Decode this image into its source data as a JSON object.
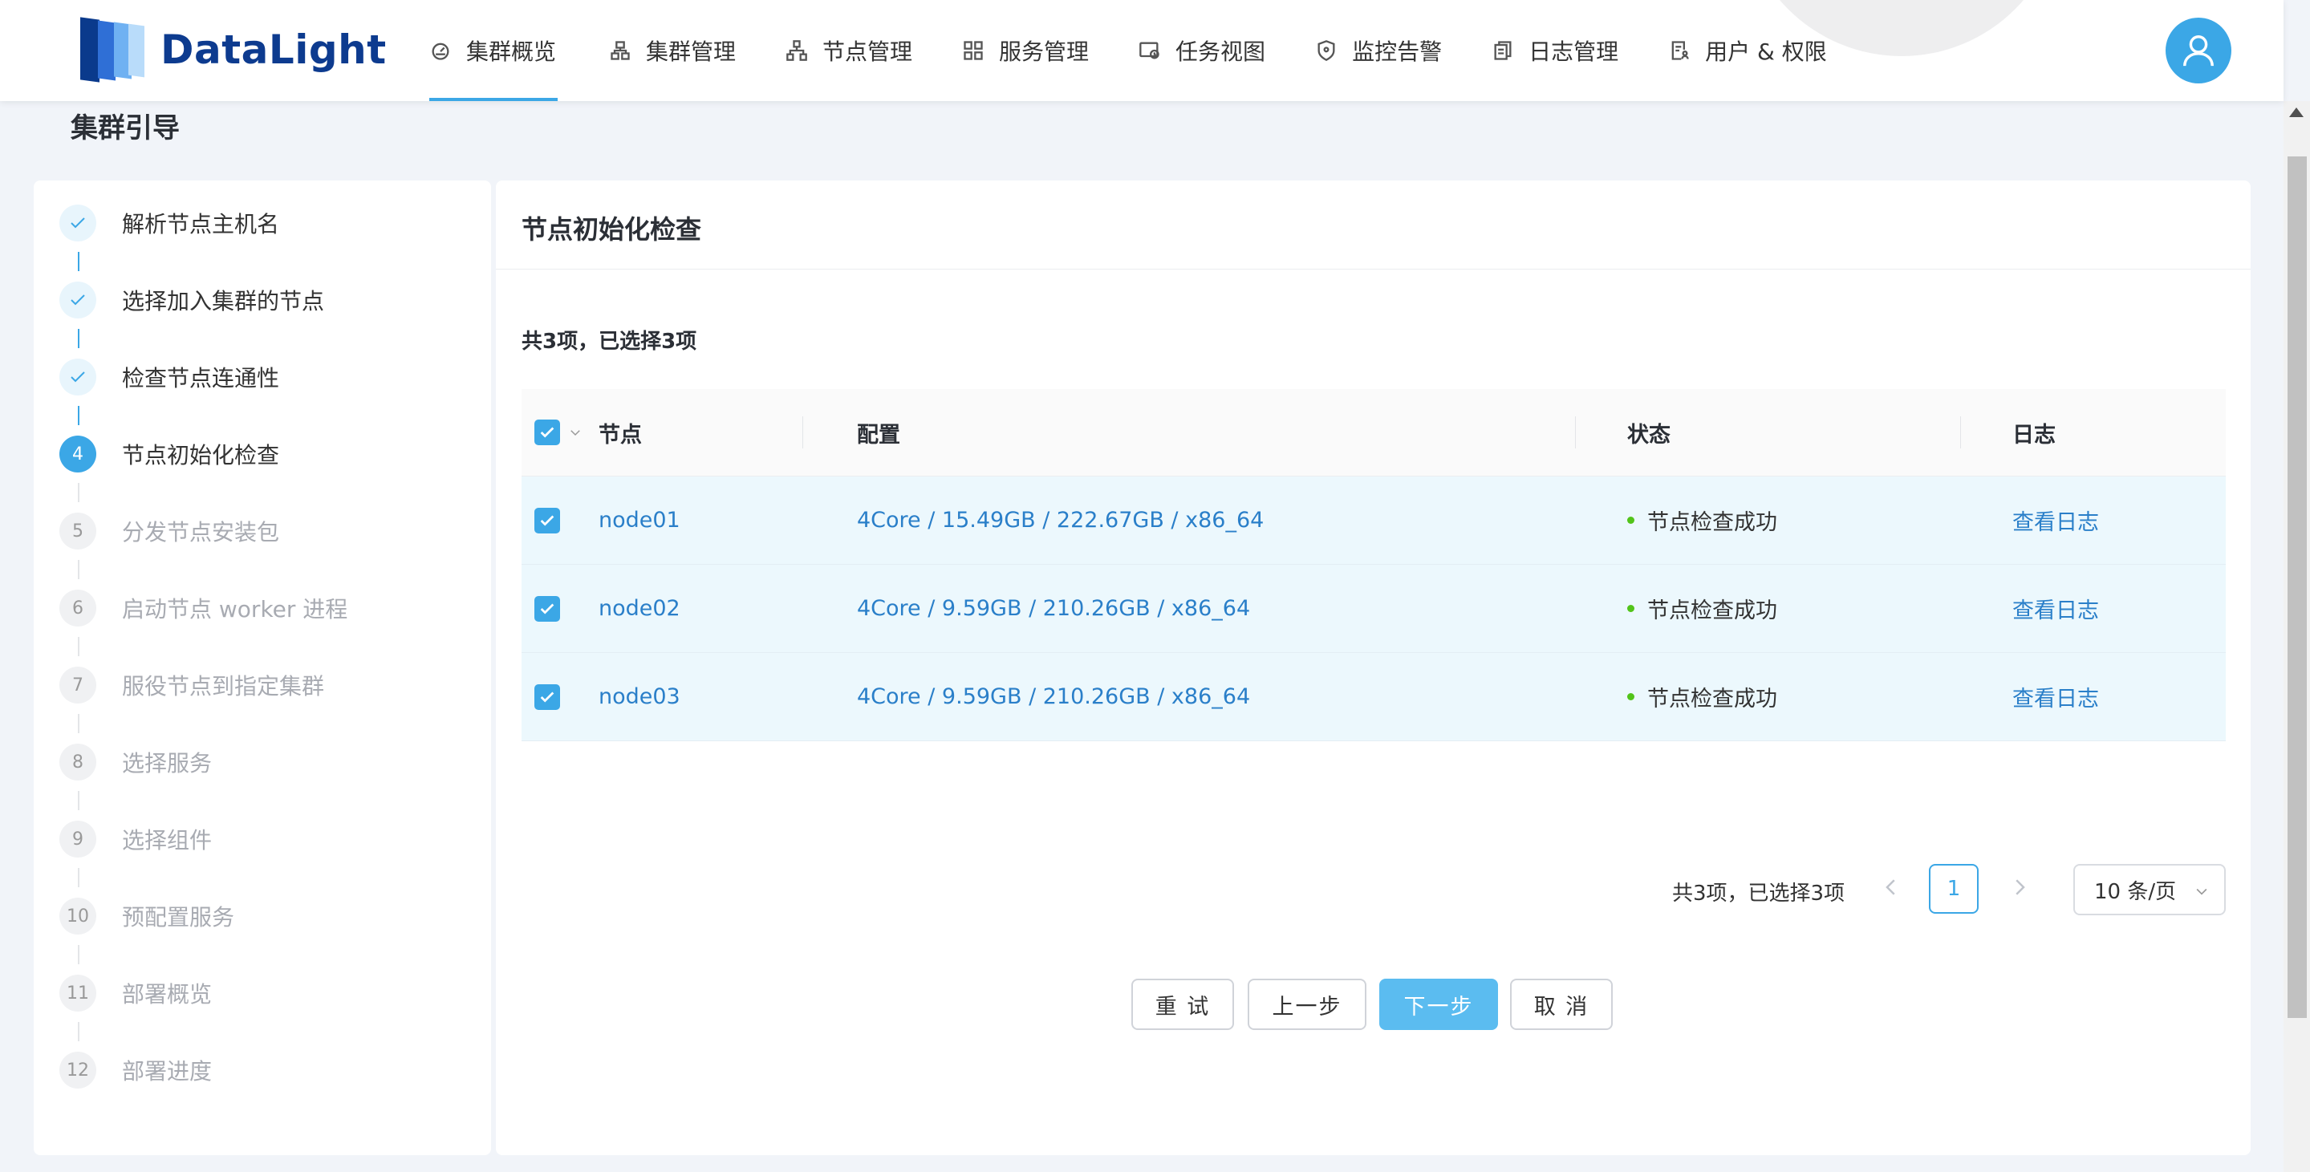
{
  "app": {
    "logo_text": "DataLight"
  },
  "nav": {
    "items": [
      {
        "label": "集群概览",
        "icon": "dashboard-icon",
        "active": true
      },
      {
        "label": "集群管理",
        "icon": "cluster-icon"
      },
      {
        "label": "节点管理",
        "icon": "nodes-icon"
      },
      {
        "label": "服务管理",
        "icon": "grid-icon"
      },
      {
        "label": "任务视图",
        "icon": "task-icon"
      },
      {
        "label": "监控告警",
        "icon": "shield-icon"
      },
      {
        "label": "日志管理",
        "icon": "log-icon"
      },
      {
        "label": "用户 & 权限",
        "icon": "user-permission-icon"
      }
    ]
  },
  "page": {
    "title": "集群引导"
  },
  "steps": [
    {
      "number": "1",
      "label": "解析节点主机名",
      "state": "done"
    },
    {
      "number": "2",
      "label": "选择加入集群的节点",
      "state": "done"
    },
    {
      "number": "3",
      "label": "检查节点连通性",
      "state": "done"
    },
    {
      "number": "4",
      "label": "节点初始化检查",
      "state": "current"
    },
    {
      "number": "5",
      "label": "分发节点安装包",
      "state": "pending"
    },
    {
      "number": "6",
      "label": "启动节点 worker 进程",
      "state": "pending"
    },
    {
      "number": "7",
      "label": "服役节点到指定集群",
      "state": "pending"
    },
    {
      "number": "8",
      "label": "选择服务",
      "state": "pending"
    },
    {
      "number": "9",
      "label": "选择组件",
      "state": "pending"
    },
    {
      "number": "10",
      "label": "预配置服务",
      "state": "pending"
    },
    {
      "number": "11",
      "label": "部署概览",
      "state": "pending"
    },
    {
      "number": "12",
      "label": "部署进度",
      "state": "pending"
    }
  ],
  "content": {
    "title": "节点初始化检查",
    "summary": "共3项，已选择3项",
    "table": {
      "headers": {
        "node": "节点",
        "config": "配置",
        "status": "状态",
        "log": "日志"
      },
      "rows": [
        {
          "node": "node01",
          "config": "4Core / 15.49GB / 222.67GB / x86_64",
          "status": "节点检查成功",
          "log": "查看日志",
          "checked": true
        },
        {
          "node": "node02",
          "config": "4Core / 9.59GB / 210.26GB / x86_64",
          "status": "节点检查成功",
          "log": "查看日志",
          "checked": true
        },
        {
          "node": "node03",
          "config": "4Core / 9.59GB / 210.26GB / x86_64",
          "status": "节点检查成功",
          "log": "查看日志",
          "checked": true
        }
      ]
    },
    "pagination": {
      "summary": "共3项，已选择3项",
      "current_page": "1",
      "page_size": "10 条/页"
    },
    "buttons": {
      "retry": "重 试",
      "prev": "上一步",
      "next": "下一步",
      "cancel": "取 消"
    }
  },
  "colors": {
    "accent": "#3ba7e6",
    "primary_button": "#5bbcf0",
    "link": "#2a7fc9",
    "success": "#52c41a",
    "row_selected": "#ecf8fd"
  }
}
